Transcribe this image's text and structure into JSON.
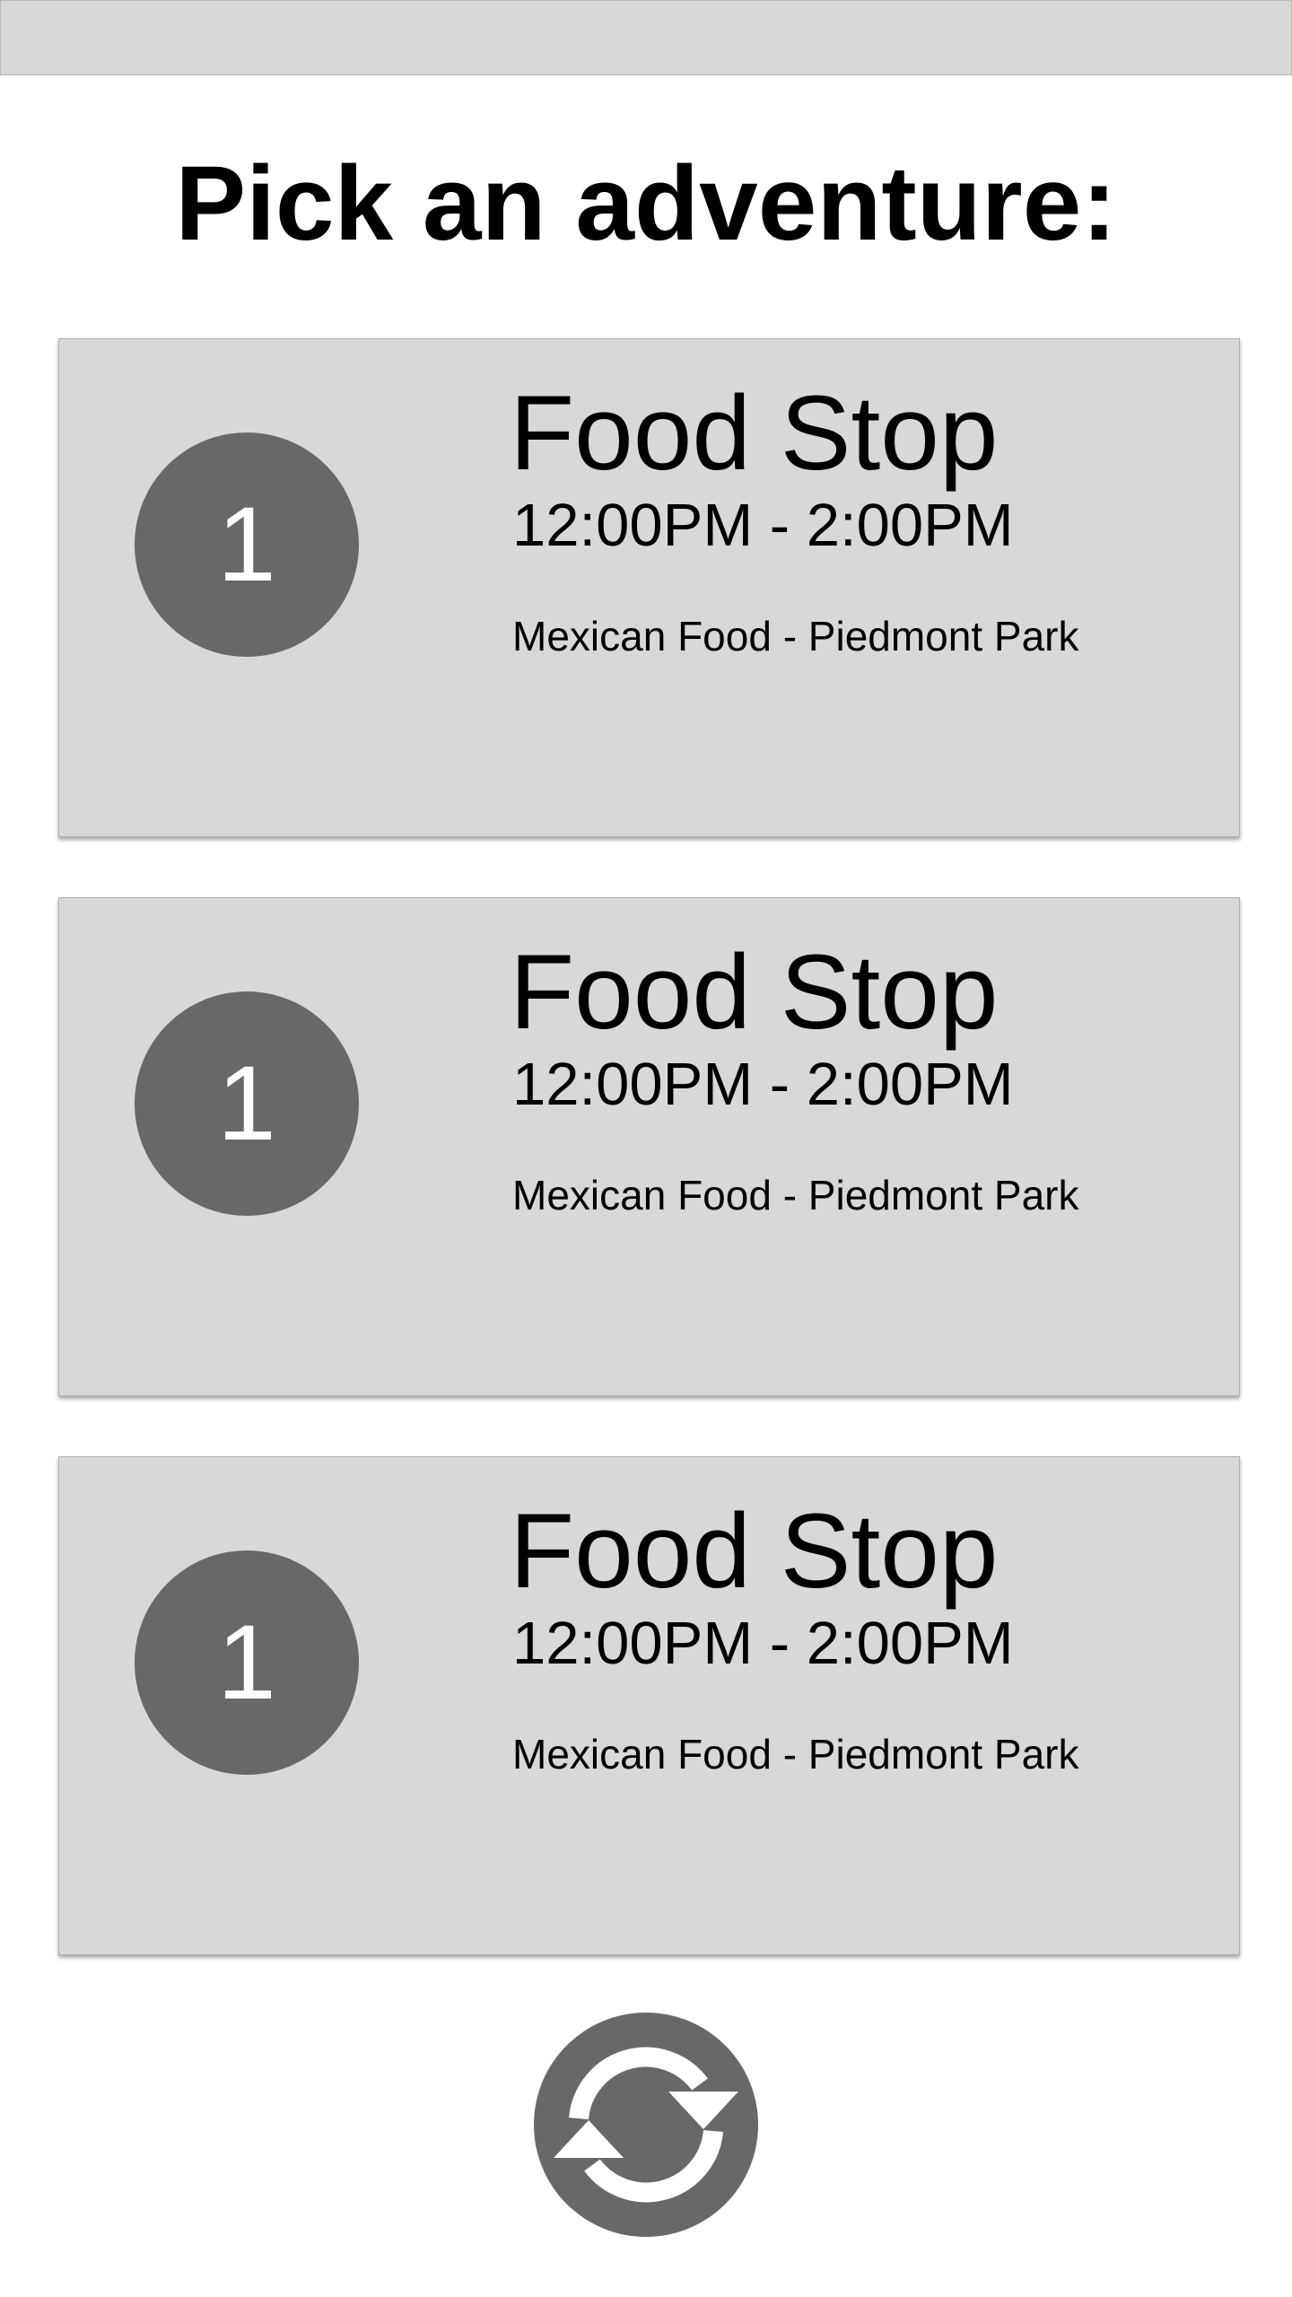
{
  "header": {
    "title": "Pick an adventure:"
  },
  "cards": [
    {
      "number": "1",
      "title": "Food Stop",
      "time": "12:00PM - 2:00PM",
      "description": "Mexican Food - Piedmont Park"
    },
    {
      "number": "1",
      "title": "Food Stop",
      "time": "12:00PM - 2:00PM",
      "description": "Mexican Food - Piedmont Park"
    },
    {
      "number": "1",
      "title": "Food Stop",
      "time": "12:00PM - 2:00PM",
      "description": "Mexican Food - Piedmont Park"
    }
  ],
  "refresh": {
    "icon": "refresh-icon"
  },
  "colors": {
    "background": "#ffffff",
    "card": "#d8d8d8",
    "badge": "#686868",
    "text": "#000000"
  }
}
